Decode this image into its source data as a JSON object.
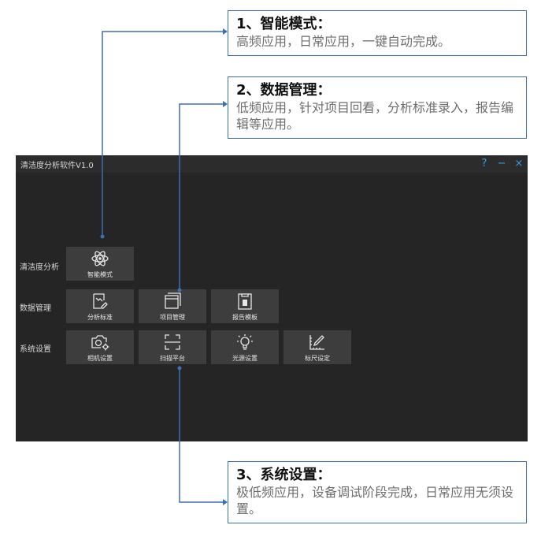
{
  "callouts": [
    {
      "title": "1、智能模式：",
      "body": "高频应用，日常应用，一键自动完成。"
    },
    {
      "title": "2、数据管理：",
      "body": "低频应用，针对项目回看，分析标准录入，报告编辑等应用。"
    },
    {
      "title": "3、系统设置：",
      "body": "极低频应用，设备调试阶段完成，日常应用无须设置。"
    }
  ],
  "app": {
    "title": "清洁度分析软件V1.0",
    "controls": [
      "?",
      "−",
      "×"
    ],
    "rows": [
      {
        "label": "清洁度分析",
        "tiles": [
          {
            "label": "智能模式",
            "icon": "atom-icon"
          }
        ]
      },
      {
        "label": "数据管理",
        "tiles": [
          {
            "label": "分析标准",
            "icon": "chart-edit-icon"
          },
          {
            "label": "项目管理",
            "icon": "window-icon"
          },
          {
            "label": "报告模板",
            "icon": "report-icon"
          }
        ]
      },
      {
        "label": "系统设置",
        "tiles": [
          {
            "label": "相机设置",
            "icon": "camera-gear-icon"
          },
          {
            "label": "扫描平台",
            "icon": "scan-icon"
          },
          {
            "label": "光源设置",
            "icon": "bulb-icon"
          },
          {
            "label": "标尺设定",
            "icon": "ruler-icon"
          }
        ]
      }
    ]
  },
  "colors": {
    "accent": "#2f9fe8",
    "window_bg": "#252525",
    "tile_bg": "#3d3d3d",
    "callout_border": "#3b6fb6"
  }
}
